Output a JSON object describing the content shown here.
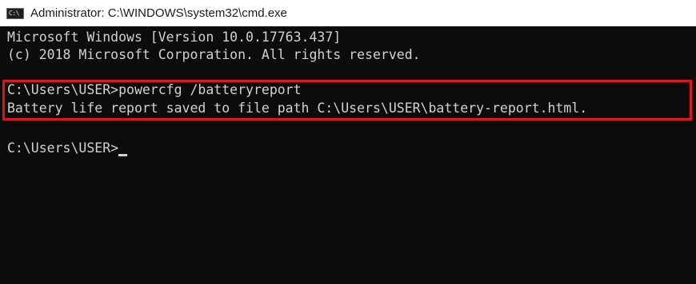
{
  "window": {
    "title": "Administrator: C:\\WINDOWS\\system32\\cmd.exe",
    "icon_label": "C:\\",
    "icon": "cmd-icon"
  },
  "console": {
    "lines": [
      "Microsoft Windows [Version 10.0.17763.437]",
      "(c) 2018 Microsoft Corporation. All rights reserved.",
      "C:\\Users\\USER>powercfg /batteryreport",
      "Battery life report saved to file path C:\\Users\\USER\\battery-report.html."
    ],
    "prompt": "C:\\Users\\USER>",
    "highlight_color": "#e0141e",
    "background_color": "#0c0c0c",
    "text_color": "#d2d2d2"
  }
}
